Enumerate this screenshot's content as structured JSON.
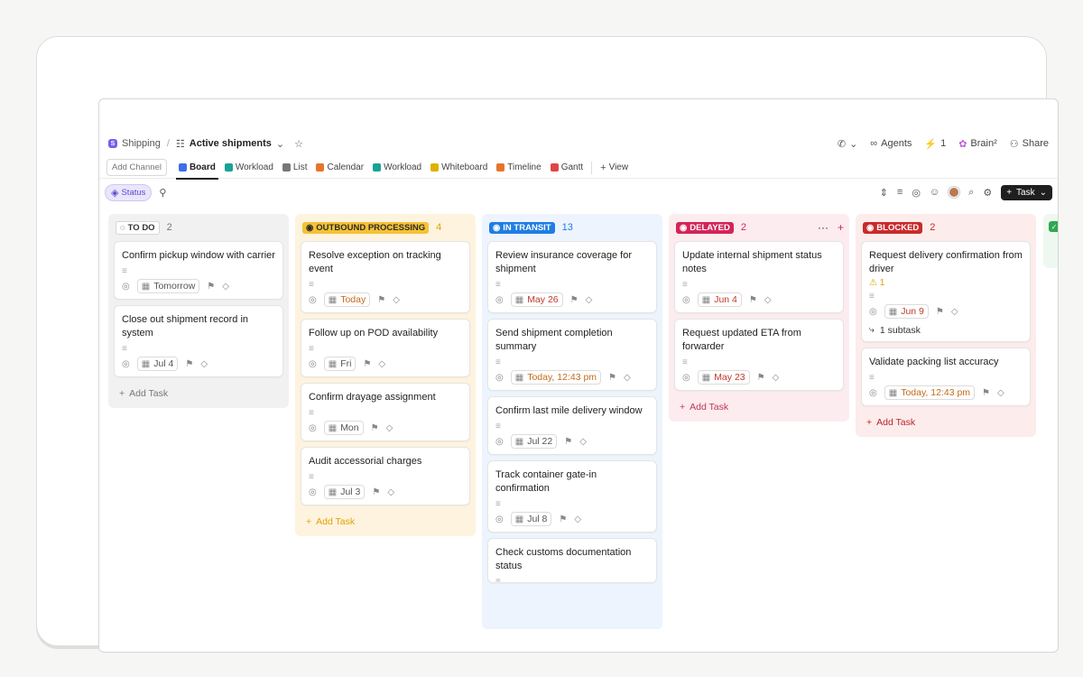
{
  "breadcrumb": {
    "space_initial": "S",
    "space": "Shipping",
    "list": "Active shipments"
  },
  "top_actions": {
    "agents": "Agents",
    "lightning_count": "1",
    "brain": "Brain²",
    "share": "Share"
  },
  "views": {
    "add_channel": "Add Channel",
    "tabs": [
      {
        "label": "Board",
        "color": "#3d6ee8"
      },
      {
        "label": "Workload",
        "color": "#19a394"
      },
      {
        "label": "List",
        "color": "#777777"
      },
      {
        "label": "Calendar",
        "color": "#e8742b"
      },
      {
        "label": "Workload",
        "color": "#19a394"
      },
      {
        "label": "Whiteboard",
        "color": "#e0b000"
      },
      {
        "label": "Timeline",
        "color": "#e8742b"
      },
      {
        "label": "Gantt",
        "color": "#e04545"
      }
    ],
    "view_label": "View"
  },
  "filter": {
    "status_label": "Status",
    "task_button": "Task"
  },
  "columns": [
    {
      "status": "TO DO",
      "count": "2",
      "bg": "#f1f1f1",
      "badge_bg": "#ffffff",
      "badge_color": "#333333",
      "count_color": "#777777",
      "add_color": "#777777",
      "add_task": "Add Task",
      "cards": [
        {
          "title": "Confirm pickup window with carrier",
          "date": "Tomorrow",
          "date_style": "normal"
        },
        {
          "title": "Close out shipment record in system",
          "date": "Jul 4",
          "date_style": "normal"
        }
      ]
    },
    {
      "status": "OUTBOUND PROCESSING",
      "count": "4",
      "bg": "#fdf3df",
      "badge_bg": "#f6c234",
      "badge_color": "#2a2a2a",
      "count_color": "#e0a200",
      "add_color": "#e0a200",
      "add_task": "Add Task",
      "cards": [
        {
          "title": "Resolve exception on tracking event",
          "date": "Today",
          "date_style": "orange"
        },
        {
          "title": "Follow up on POD availability",
          "date": "Fri",
          "date_style": "normal"
        },
        {
          "title": "Confirm drayage assignment",
          "date": "Mon",
          "date_style": "normal"
        },
        {
          "title": "Audit accessorial charges",
          "date": "Jul 3",
          "date_style": "normal"
        }
      ]
    },
    {
      "status": "IN TRANSIT",
      "count": "13",
      "bg": "#edf4fd",
      "badge_bg": "#1f7de3",
      "badge_color": "#ffffff",
      "count_color": "#1f7de3",
      "add_color": "#1f7de3",
      "add_task": "",
      "cards": [
        {
          "title": "Review insurance coverage for shipment",
          "date": "May 26",
          "date_style": "red"
        },
        {
          "title": "Send shipment completion summary",
          "date": "Today, 12:43 pm",
          "date_style": "orange"
        },
        {
          "title": "Confirm last mile delivery window",
          "date": "Jul 22",
          "date_style": "normal"
        },
        {
          "title": "Track container gate-in confirmation",
          "date": "Jul 8",
          "date_style": "normal"
        },
        {
          "title": "Check customs documentation status",
          "date": "",
          "date_style": "none"
        }
      ]
    },
    {
      "status": "DELAYED",
      "count": "2",
      "bg": "#fcecef",
      "badge_bg": "#d3245a",
      "badge_color": "#ffffff",
      "count_color": "#d3245a",
      "add_color": "#c0345a",
      "add_task": "Add Task",
      "cards": [
        {
          "title": "Update internal shipment status notes",
          "date": "Jun 4",
          "date_style": "red"
        },
        {
          "title": "Request updated ETA from forwarder",
          "date": "May 23",
          "date_style": "red"
        }
      ]
    },
    {
      "status": "BLOCKED",
      "count": "2",
      "bg": "#fcecec",
      "badge_bg": "#c92a2a",
      "badge_color": "#ffffff",
      "count_color": "#c92a2a",
      "add_color": "#b52828",
      "add_task": "Add Task",
      "cards": [
        {
          "title": "Request delivery confirmation from driver",
          "date": "Jun 9",
          "date_style": "red",
          "warning": "1",
          "subtask": "1 subtask"
        },
        {
          "title": "Validate packing list accuracy",
          "date": "Today, 12:43 pm",
          "date_style": "orange"
        }
      ]
    }
  ]
}
